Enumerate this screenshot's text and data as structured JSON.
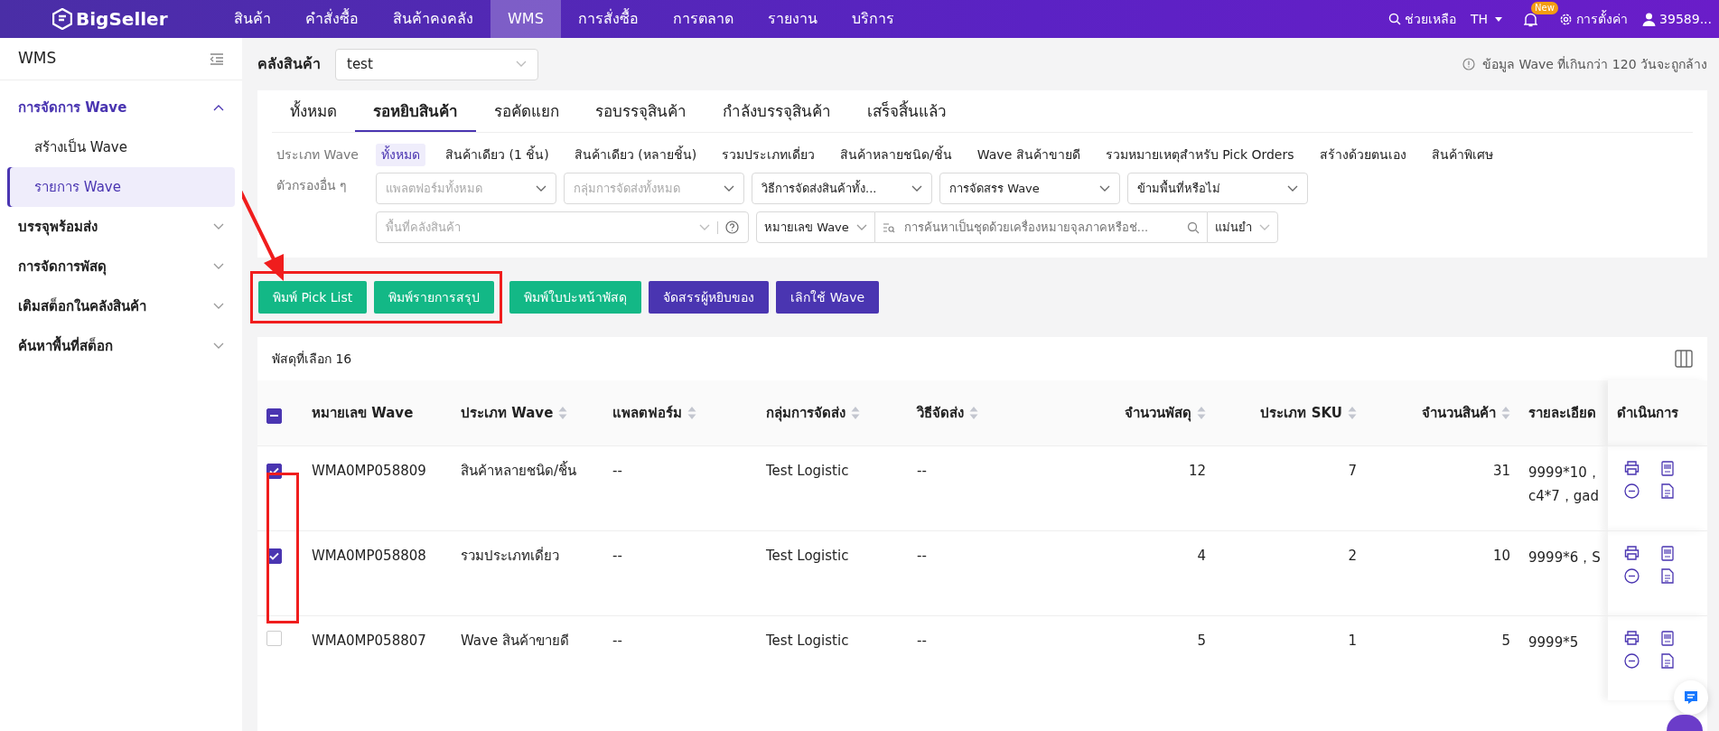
{
  "topbar": {
    "logo": "BigSeller",
    "menu": [
      {
        "label": "สินค้า",
        "selected": false
      },
      {
        "label": "คำสั่งซื้อ",
        "selected": false
      },
      {
        "label": "สินค้าคงคลัง",
        "selected": false
      },
      {
        "label": "WMS",
        "selected": true
      },
      {
        "label": "การสั่งซื้อ",
        "selected": false
      },
      {
        "label": "การตลาด",
        "selected": false
      },
      {
        "label": "รายงาน",
        "selected": false
      },
      {
        "label": "บริการ",
        "selected": false
      }
    ],
    "help": "ช่วยเหลือ",
    "language": "TH",
    "new_badge": "New",
    "settings": "การตั้งค่า",
    "user": "39589..."
  },
  "sidebar": {
    "title": "WMS",
    "items": [
      {
        "label": "การจัดการ Wave",
        "expanded": true,
        "selected": false,
        "children": [
          {
            "label": "สร้างเป็น Wave",
            "selected": false
          },
          {
            "label": "รายการ Wave",
            "selected": true
          }
        ]
      },
      {
        "label": "บรรจุพร้อมส่ง",
        "expanded": false,
        "selected": false
      },
      {
        "label": "การจัดการพัสดุ",
        "expanded": false,
        "selected": false
      },
      {
        "label": "เติมสต็อกในคลังสินค้า",
        "expanded": false,
        "selected": false
      },
      {
        "label": "ค้นหาพื้นที่สต็อก",
        "expanded": false,
        "selected": false
      }
    ]
  },
  "warehouse": {
    "label": "คลังสินค้า",
    "value": "test"
  },
  "notice": "ข้อมูล Wave ที่เกินกว่า 120 วันจะถูกล้าง",
  "tabs": [
    {
      "label": "ทั้งหมด",
      "selected": false
    },
    {
      "label": "รอหยิบสินค้า",
      "selected": true
    },
    {
      "label": "รอคัดแยก",
      "selected": false
    },
    {
      "label": "รอบรรจุสินค้า",
      "selected": false
    },
    {
      "label": "กำลังบรรจุสินค้า",
      "selected": false
    },
    {
      "label": "เสร็จสิ้นแล้ว",
      "selected": false
    }
  ],
  "wave_type": {
    "label": "ประเภท Wave",
    "options": [
      {
        "label": "ทั้งหมด",
        "selected": true
      },
      {
        "label": "สินค้าเดียว (1 ชิ้น)",
        "selected": false
      },
      {
        "label": "สินค้าเดียว (หลายชิ้น)",
        "selected": false
      },
      {
        "label": "รวมประเภทเดี่ยว",
        "selected": false
      },
      {
        "label": "สินค้าหลายชนิด/ชิ้น",
        "selected": false
      },
      {
        "label": "Wave สินค้าขายดี",
        "selected": false
      },
      {
        "label": "รวมหมายเหตุสำหรับ Pick Orders",
        "selected": false
      },
      {
        "label": "สร้างด้วยตนเอง",
        "selected": false
      },
      {
        "label": "สินค้าพิเศษ",
        "selected": false
      }
    ]
  },
  "filters": {
    "label": "ตัวกรองอื่น ๆ",
    "dropdowns": [
      {
        "placeholder": "แพลตฟอร์มทั้งหมด"
      },
      {
        "placeholder": "กลุ่มการจัดส่งทั้งหมด"
      },
      {
        "value": "วิธีการจัดส่งสินค้าทั้ง..."
      },
      {
        "value": "การจัดสรร Wave"
      },
      {
        "value": "ข้ามพื้นที่หรือไม่"
      }
    ],
    "area": {
      "placeholder": "พื้นที่คลังสินค้า"
    },
    "search_by": "หมายเลข Wave",
    "search": {
      "placeholder": "การค้นหาเป็นชุดด้วยเครื่องหมายจุลภาคหรือช่..."
    },
    "match": "แม่นยำ"
  },
  "actions": [
    {
      "label": "พิมพ์ Pick List",
      "color": "#13b886"
    },
    {
      "label": "พิมพ์รายการสรุป",
      "color": "#13b886"
    },
    {
      "label": "พิมพ์ใบปะหน้าพัสดุ",
      "color": "#13b886"
    },
    {
      "label": "จัดสรรผู้หยิบของ",
      "color": "#4a35b1"
    },
    {
      "label": "เลิกใช้ Wave",
      "color": "#4a35b1"
    }
  ],
  "selected_count": "พัสดุที่เลือก 16",
  "table": {
    "select_all_indeterminate": true,
    "columns": [
      {
        "label": "หมายเลข Wave",
        "sortable": false
      },
      {
        "label": "ประเภท Wave",
        "sortable": true
      },
      {
        "label": "แพลตฟอร์ม",
        "sortable": true
      },
      {
        "label": "กลุ่มการจัดส่ง",
        "sortable": true
      },
      {
        "label": "วิธีจัดส่ง",
        "sortable": true
      },
      {
        "label": "จำนวนพัสดุ",
        "sortable": true
      },
      {
        "label": "ประเภท SKU",
        "sortable": true
      },
      {
        "label": "จำนวนสินค้า",
        "sortable": true
      },
      {
        "label": "รายละเอียด",
        "sortable": false
      },
      {
        "label": "ดำเนินการ",
        "sortable": false
      }
    ],
    "rows": [
      {
        "checked": true,
        "cells": [
          "WMA0MP058809",
          "สินค้าหลายชนิด/ชิ้น",
          "--",
          "Test Logistic",
          "--",
          "12",
          "7",
          "31"
        ],
        "details": [
          "9999*10，",
          "c4*7，gad"
        ]
      },
      {
        "checked": true,
        "cells": [
          "WMA0MP058808",
          "รวมประเภทเดี่ยว",
          "--",
          "Test Logistic",
          "--",
          "4",
          "2",
          "10"
        ],
        "details": [
          "9999*6，S"
        ]
      },
      {
        "checked": false,
        "cells": [
          "WMA0MP058807",
          "Wave สินค้าขายดี",
          "--",
          "Test Logistic",
          "--",
          "5",
          "1",
          "5"
        ],
        "details": [
          "9999*5"
        ]
      }
    ]
  }
}
